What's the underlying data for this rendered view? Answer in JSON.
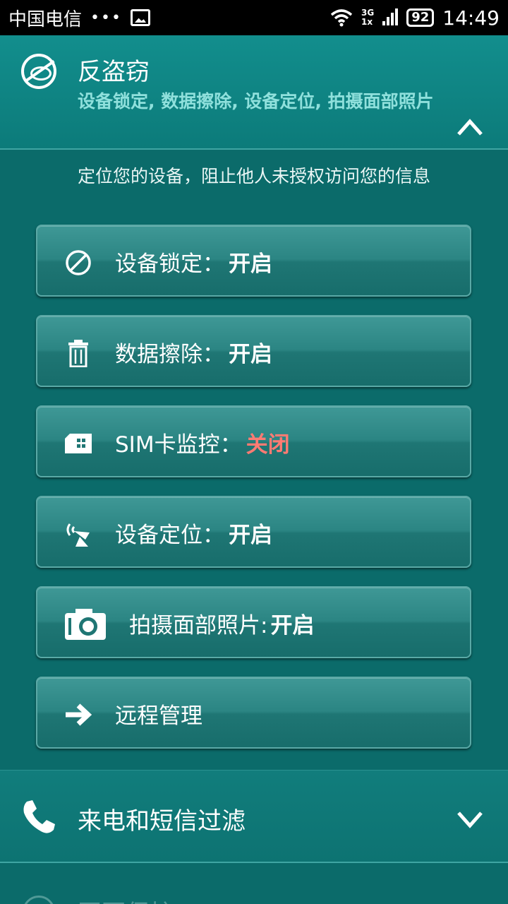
{
  "status_bar": {
    "carrier": "中国电信",
    "dots": "•••",
    "network_top": "3G",
    "network_bottom": "1x",
    "battery": "92",
    "time": "14:49"
  },
  "anti_theft": {
    "title": "反盗窃",
    "subtitle": "设备锁定, 数据擦除, 设备定位, 拍摄面部照片",
    "description": "定位您的设备，阻止他人未授权访问您的信息",
    "icon": "anti-theft-icon"
  },
  "features": [
    {
      "icon": "block-icon",
      "label": "设备锁定：",
      "value": "开启"
    },
    {
      "icon": "trash-icon",
      "label": "数据擦除：",
      "value": "开启"
    },
    {
      "icon": "sim-card-icon",
      "label": "SIM卡监控：",
      "value": "关闭"
    },
    {
      "icon": "satellite-icon",
      "label": "设备定位：",
      "value": "开启"
    },
    {
      "icon": "camera-icon",
      "label": "拍摄面部照片:",
      "value": "开启"
    },
    {
      "icon": "arrow-right-icon",
      "label": "远程管理",
      "value": ""
    }
  ],
  "call_filter": {
    "title": "来电和短信过滤",
    "icon": "phone-icon"
  },
  "next_section": {
    "title": "网页保护"
  },
  "colors": {
    "background": "#0b6b6a",
    "subtitle": "#8fe0dc",
    "off_value": "#ff7b73"
  }
}
